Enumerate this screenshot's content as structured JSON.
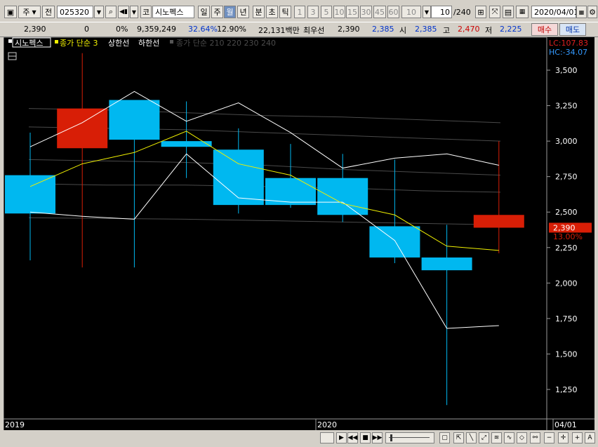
{
  "toolbar": {
    "period_select": "주",
    "prev_label": "전",
    "code": "025320",
    "market_label": "코",
    "stock_name": "시노펙스",
    "period_tabs": [
      "일",
      "주",
      "월",
      "년",
      "분",
      "초",
      "틱"
    ],
    "active_period": "월",
    "intervals": [
      "1",
      "3",
      "5",
      "10",
      "15",
      "30",
      "45",
      "60",
      "10"
    ],
    "count": "10",
    "count_total": "/240",
    "date": "2020/04/01"
  },
  "infobar": {
    "price": "2,390",
    "change": "0",
    "change_pct": "0%",
    "volume": "9,359,249",
    "turnover_pct": "32.64%",
    "ratio_pct": "12.90%",
    "amount": "22,131백만",
    "best_label": "최우선",
    "best_sell": "2,390",
    "best_buy": "2,385",
    "open_label": "시",
    "open": "2,385",
    "high_label": "고",
    "high": "2,470",
    "low_label": "저",
    "low": "2,225",
    "buy_label": "매수",
    "sell_label": "매도"
  },
  "legend": {
    "name": "시노펙스",
    "ma3": "종가 단순 3",
    "upper": "상한선",
    "lower": "하한선",
    "ma_multi": "종가 단순 210 220 230 240"
  },
  "right_labels": {
    "lc": "LC:107.83",
    "hc": "HC:-34.07",
    "price_tag": "2,390",
    "pct_tag": "13.00%"
  },
  "colors": {
    "up": "#d81e06",
    "down": "#00b8f0",
    "ma3": "#f0f000",
    "band": "#ffffff",
    "background": "#000000"
  },
  "chart_data": {
    "type": "candlestick",
    "x": [
      "2019-06",
      "2019-07",
      "2019-08",
      "2019-09",
      "2019-10",
      "2019-11",
      "2019-12",
      "2020-01",
      "2020-02",
      "2020-03"
    ],
    "open": [
      2760,
      2950,
      3290,
      3000,
      2940,
      2740,
      2740,
      2400,
      2180,
      2390
    ],
    "close": [
      2490,
      3230,
      3010,
      2960,
      2550,
      2550,
      2480,
      2180,
      2090,
      2480
    ],
    "high": [
      3060,
      3620,
      3260,
      3280,
      3090,
      2980,
      2910,
      2870,
      2410,
      3000
    ],
    "low": [
      2160,
      2110,
      2110,
      2740,
      2490,
      2530,
      2430,
      2140,
      1140,
      2210
    ],
    "ma3": [
      2680,
      2840,
      2920,
      3070,
      2840,
      2760,
      2560,
      2480,
      2260,
      2230
    ],
    "upper": [
      2960,
      3130,
      3350,
      3140,
      3270,
      3060,
      2810,
      2880,
      2910,
      2830
    ],
    "lower": [
      2500,
      2470,
      2450,
      2910,
      2600,
      2570,
      2570,
      2300,
      1680,
      1700
    ],
    "y_ticks": [
      "3,500",
      "3,250",
      "3,000",
      "2,750",
      "2,500",
      "2,250",
      "2,000",
      "1,750",
      "1,500",
      "1,250"
    ],
    "x_labels": [
      "2019",
      "2020",
      "04/01"
    ],
    "ylim": [
      1100,
      3620
    ]
  }
}
